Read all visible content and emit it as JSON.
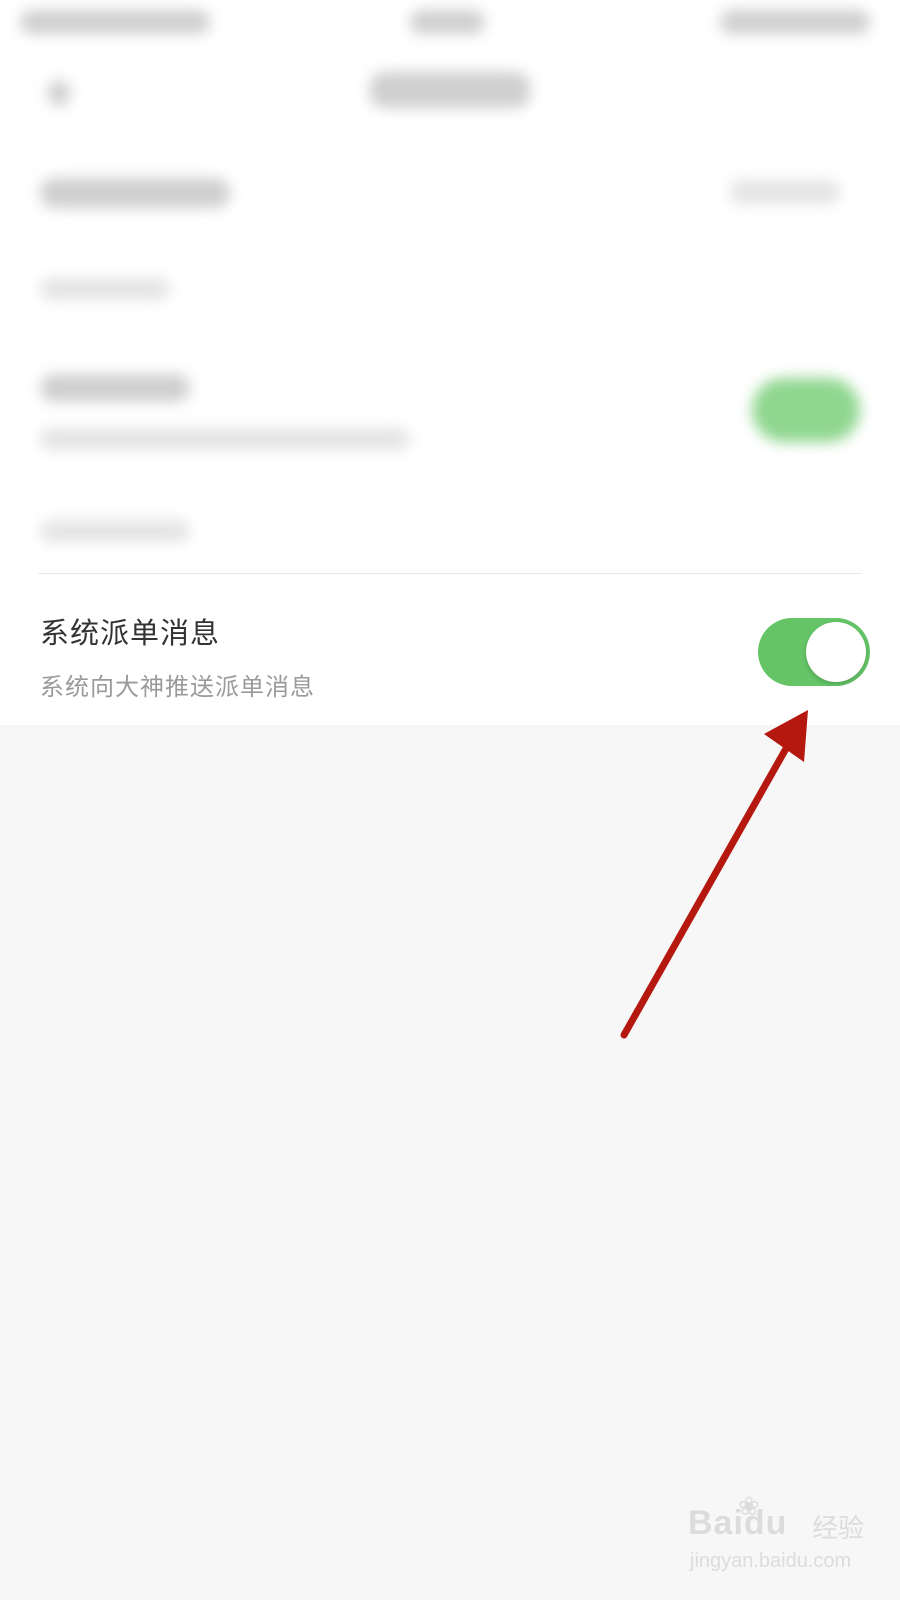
{
  "setting": {
    "title": "系统派单消息",
    "description": "系统向大神推送派单消息",
    "enabled": true
  },
  "colors": {
    "toggle_on": "#64c466",
    "arrow": "#b5180f",
    "page_background": "#f7f7f7"
  },
  "watermark": {
    "logo": "Baidu",
    "brand": "经验",
    "url": "jingyan.baidu.com"
  }
}
